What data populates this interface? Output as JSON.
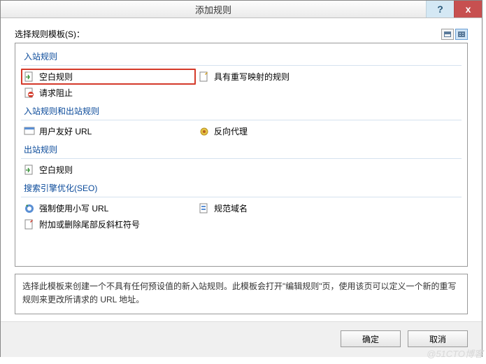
{
  "titlebar": {
    "title": "添加规则",
    "help": "?",
    "close": "x"
  },
  "main": {
    "select_label": "选择规则模板(S)：",
    "groups": {
      "inbound": "入站规则",
      "inout": "入站规则和出站规则",
      "outbound": "出站规则",
      "seo": "搜索引擎优化(SEO)"
    },
    "items": {
      "blank_rule": "空白规则",
      "rewrite_map": "具有重写映射的规则",
      "request_block": "请求阻止",
      "user_friendly": "用户友好 URL",
      "reverse_proxy": "反向代理",
      "blank_rule_out": "空白规则",
      "force_lower": "强制使用小写 URL",
      "canonical": "规范域名",
      "trailing_slash": "附加或删除尾部反斜杠符号"
    },
    "description": "选择此模板来创建一个不具有任何预设值的新入站规则。此模板会打开\"编辑规则\"页，使用该页可以定义一个新的重写规则来更改所请求的 URL 地址。"
  },
  "buttons": {
    "ok": "确定",
    "cancel": "取消"
  },
  "watermark": "@51CTO博客"
}
